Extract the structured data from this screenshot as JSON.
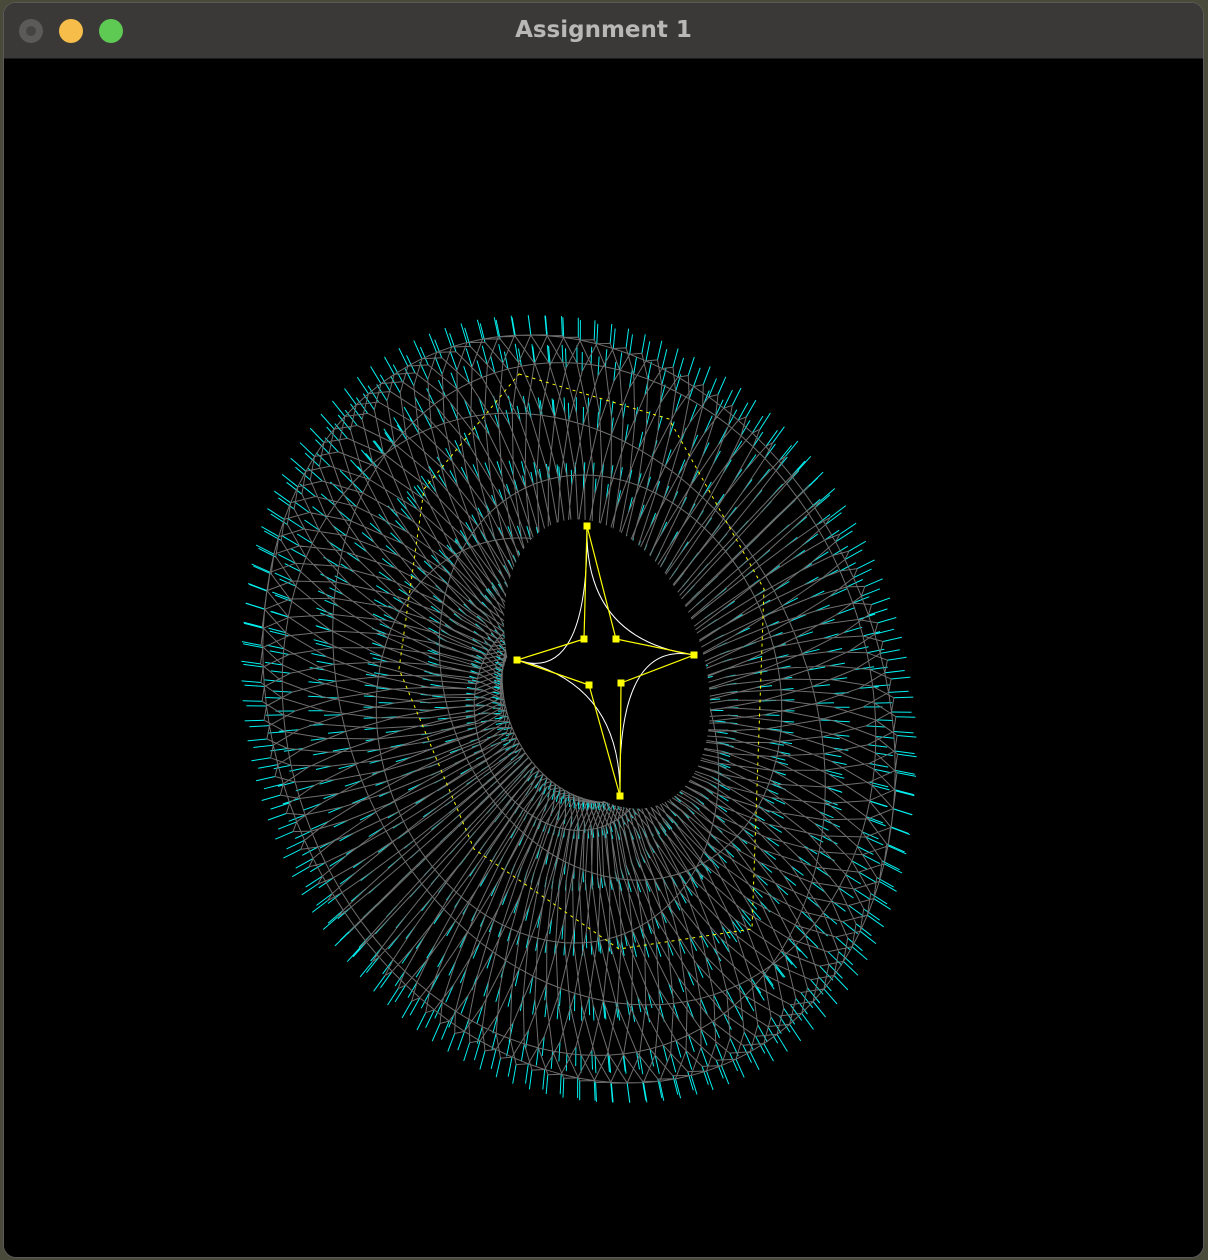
{
  "window": {
    "title": "Assignment 1"
  },
  "scene": {
    "background": "#000000",
    "surface_wire_color": "#6e6e6e",
    "normal_color": "#00f0f0",
    "curve_color": "#ffffff",
    "control_color": "#ffff00"
  }
}
